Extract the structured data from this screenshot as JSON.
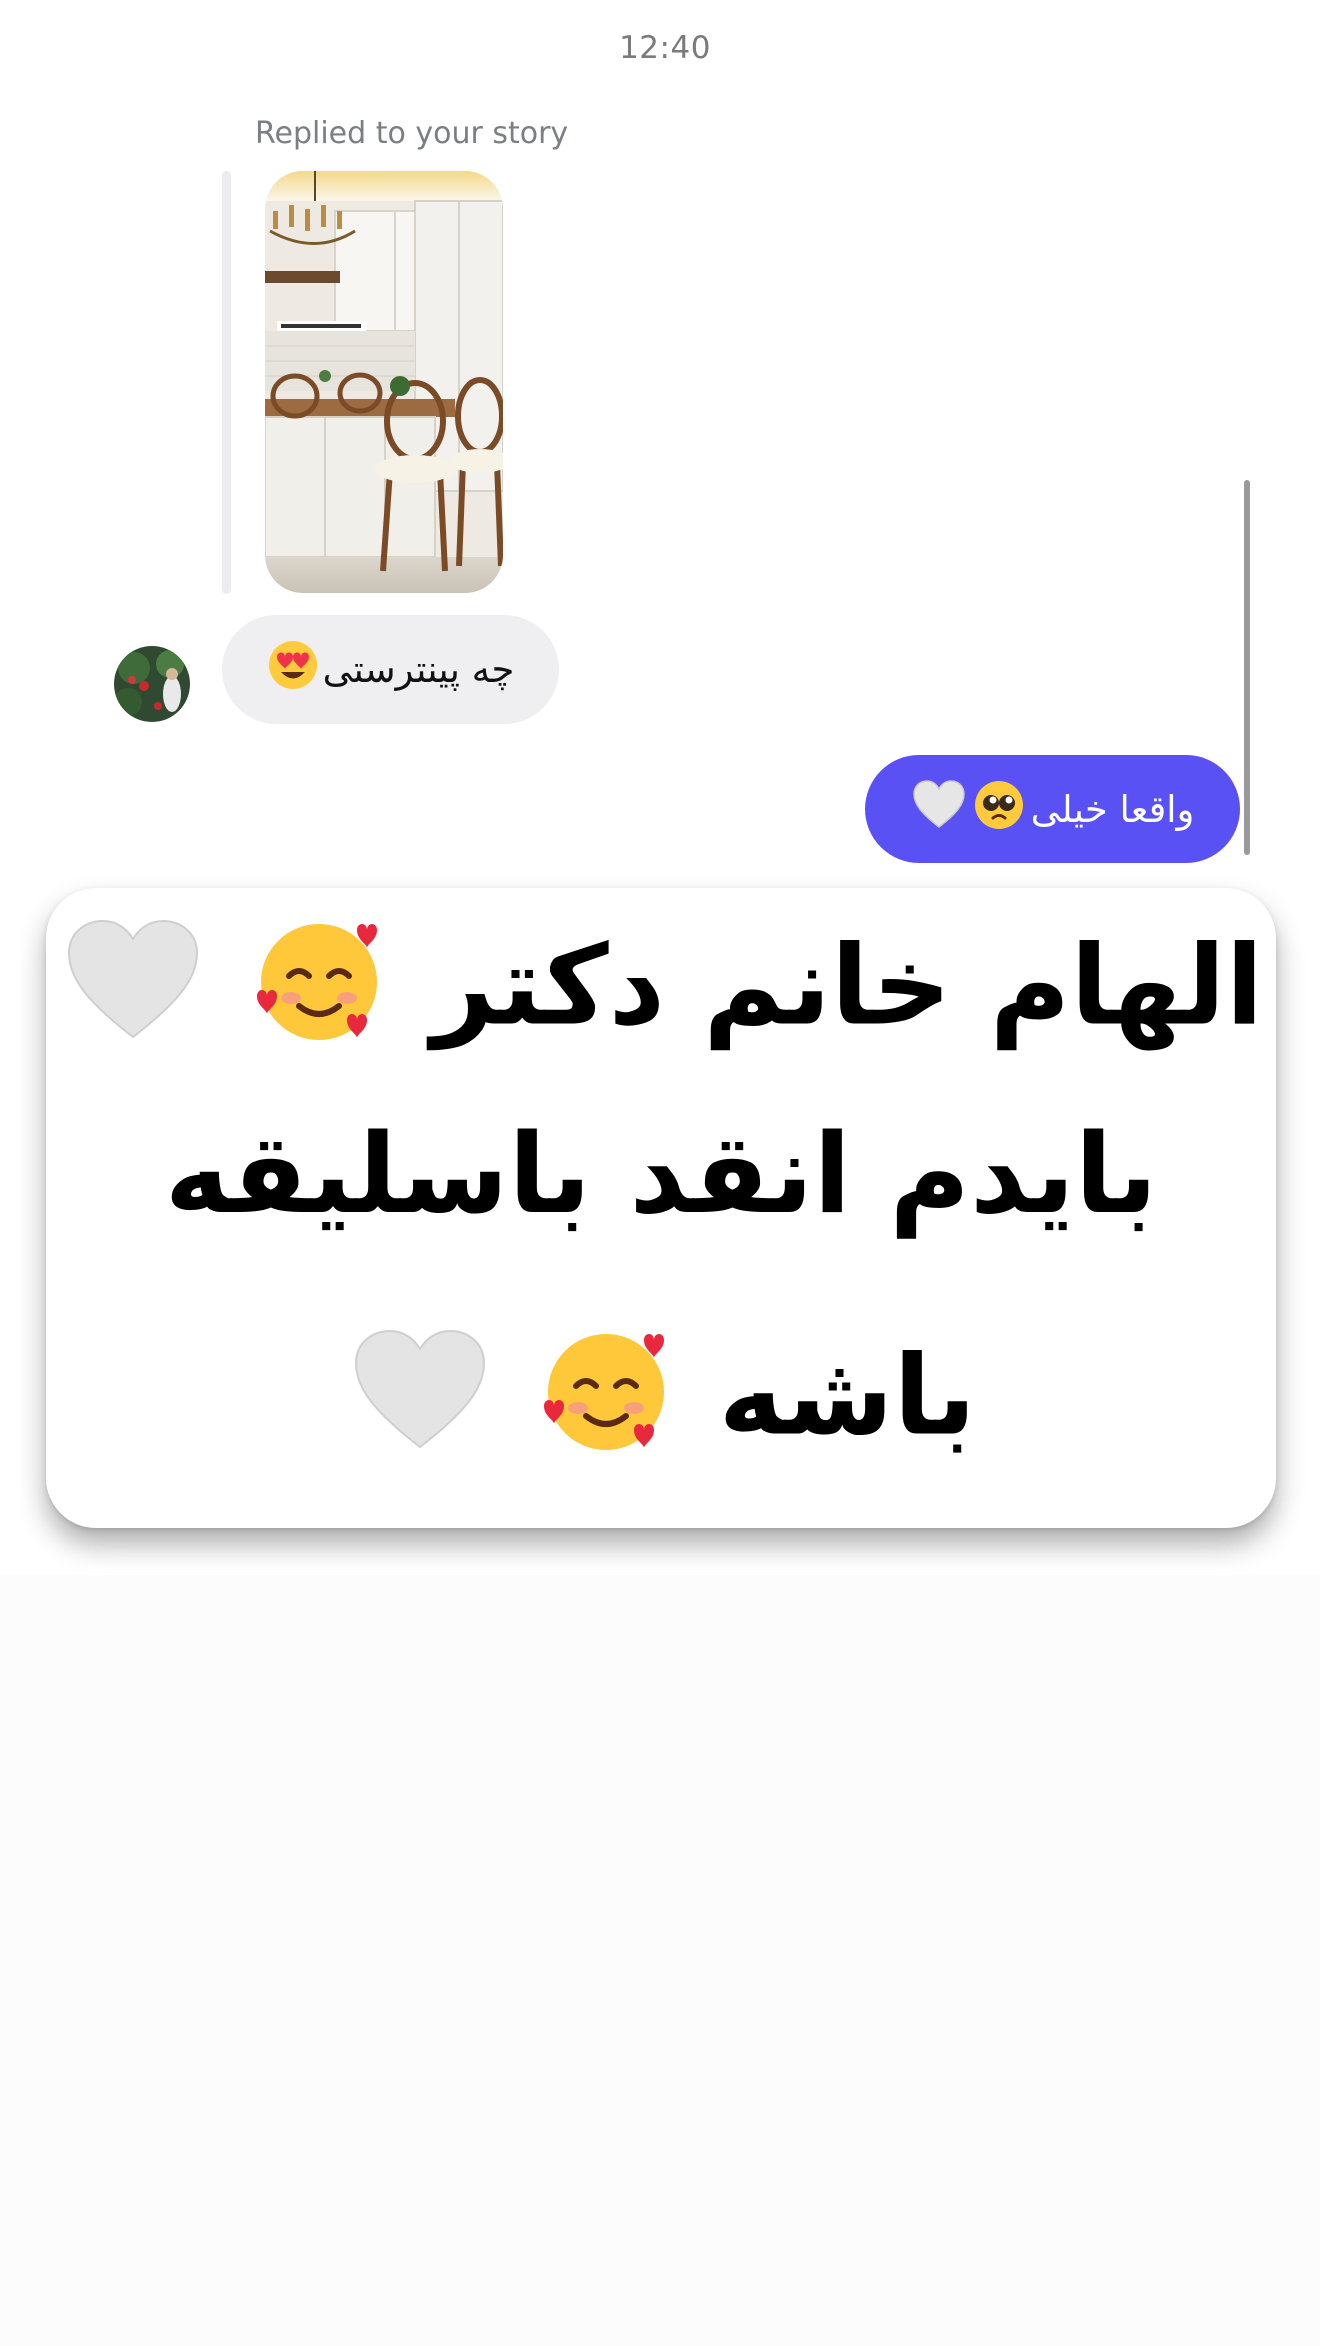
{
  "status": {
    "time": "12:40"
  },
  "conversation": {
    "reply_caption": "Replied to your story",
    "incoming_message": {
      "text": "چه پینترستی",
      "emoji": "heart-eyes-emoji"
    },
    "outgoing_message": {
      "text": "واقعا خیلی",
      "emojis": [
        "pleading-face-emoji",
        "white-heart-emoji"
      ]
    }
  },
  "overlay": {
    "line1": "الهام خانم دکتر",
    "line2": "بایدم انقد باسلیقه",
    "line3": "باشه",
    "emojis": [
      "smiling-face-with-hearts-emoji",
      "white-heart-emoji"
    ]
  },
  "colors": {
    "outgoing_bubble": "#5a51f5",
    "incoming_bubble": "#efeff1",
    "background": "#fcfcfc"
  }
}
